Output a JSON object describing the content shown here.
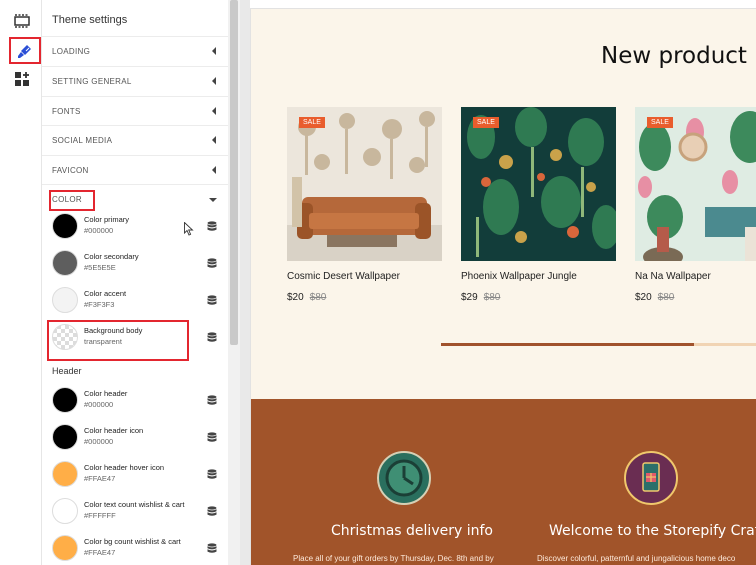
{
  "panel": {
    "title": "Theme settings"
  },
  "sections": [
    {
      "label": "LOADING"
    },
    {
      "label": "SETTING GENERAL"
    },
    {
      "label": "FONTS"
    },
    {
      "label": "SOCIAL MEDIA"
    },
    {
      "label": "FAVICON"
    },
    {
      "label": "COLOR"
    }
  ],
  "colors": [
    {
      "name": "Color primary",
      "value": "#000000",
      "swatch": "#000000"
    },
    {
      "name": "Color secondary",
      "value": "#5E5E5E",
      "swatch": "#5E5E5E"
    },
    {
      "name": "Color accent",
      "value": "#F3F3F3",
      "swatch": "#F3F3F3"
    },
    {
      "name": "Background body",
      "value": "transparent",
      "swatch": "transparent"
    }
  ],
  "header_label": "Header",
  "header_colors": [
    {
      "name": "Color header",
      "value": "#000000",
      "swatch": "#000000"
    },
    {
      "name": "Color header icon",
      "value": "#000000",
      "swatch": "#000000"
    },
    {
      "name": "Color header hover icon",
      "value": "#FFAE47",
      "swatch": "#FFAE47"
    },
    {
      "name": "Color text count wishlist & cart",
      "value": "#FFFFFF",
      "swatch": "#FFFFFF"
    },
    {
      "name": "Color bg count wishlist & cart",
      "value": "#FFAE47",
      "swatch": "#FFAE47"
    }
  ],
  "preview": {
    "new_product_title": "New product",
    "products": [
      {
        "badge": "SALE",
        "name": "Cosmic Desert Wallpaper",
        "price": "$20",
        "old_price": "$80"
      },
      {
        "badge": "SALE",
        "name": "Phoenix Wallpaper Jungle",
        "price": "$29",
        "old_price": "$80"
      },
      {
        "badge": "SALE",
        "name": "Na Na Wallpaper",
        "price": "$20",
        "old_price": "$80"
      }
    ],
    "carousel_progress": 0.8,
    "features": [
      {
        "icon": "clock-icon",
        "title": "Christmas delivery info",
        "text": "Place all of your gift orders by Thursday, Dec. 8th and by"
      },
      {
        "icon": "gift-phone-icon",
        "title": "Welcome to the Storepify Craft!",
        "text": "Discover colorful, patternful and jungalicious home deco"
      }
    ]
  },
  "theme": {
    "accent": "#e3262f",
    "brand": "#a1542a",
    "sale": "#e95d2d",
    "preview_bg": "#fbf5ea",
    "active_icon": "#2b4fd6"
  }
}
